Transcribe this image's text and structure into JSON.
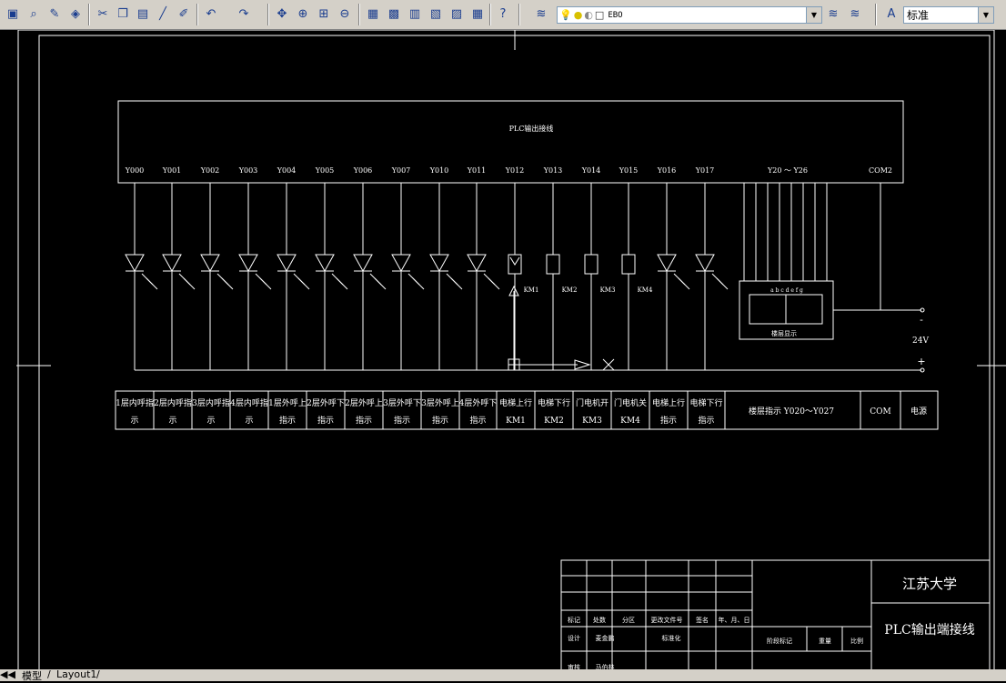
{
  "toolbar": {
    "layer_value": "EBO",
    "text_style_value": "标准",
    "icons": [
      "open-icon",
      "preview-icon",
      "publish-icon",
      "plot-icon",
      "cut-icon",
      "copy-icon",
      "paste-icon",
      "match-icon",
      "brush-icon",
      "undo-icon",
      "redo-icon",
      "pan-icon",
      "zoom-realtime-icon",
      "zoom-window-icon",
      "zoom-previous-icon",
      "properties-icon",
      "design-center-icon",
      "tool-palette-icon",
      "sheet-set-icon",
      "markup-icon",
      "quickcalc-icon",
      "help-icon"
    ]
  },
  "drawing": {
    "plc_title": "PLC输出接线",
    "output_labels": [
      "Y000",
      "Y001",
      "Y002",
      "Y003",
      "Y004",
      "Y005",
      "Y006",
      "Y007",
      "Y010",
      "Y011",
      "Y012",
      "Y013",
      "Y014",
      "Y015",
      "Y016",
      "Y017"
    ],
    "y20_label": "Y20 ～ Y26",
    "com2_label": "COM2",
    "relay_labels": [
      "KM1",
      "KM2",
      "KM3",
      "KM4"
    ],
    "display_segments": "a b c d e f g",
    "display_label": "楼层显示",
    "supply_voltage": "24V",
    "minus_sign": "-",
    "plus_sign": "+",
    "table_cells": [
      [
        "1层内呼指",
        "示"
      ],
      [
        "2层内呼指",
        "示"
      ],
      [
        "3层内呼指",
        "示"
      ],
      [
        "4层内呼指",
        "示"
      ],
      [
        "1层外呼上",
        "指示"
      ],
      [
        "2层外呼下",
        "指示"
      ],
      [
        "2层外呼上",
        "指示"
      ],
      [
        "3层外呼下",
        "指示"
      ],
      [
        "3层外呼上",
        "指示"
      ],
      [
        "4层外呼下",
        "指示"
      ],
      [
        "电梯上行",
        "KM1"
      ],
      [
        "电梯下行",
        "KM2"
      ],
      [
        "门电机开",
        "KM3"
      ],
      [
        "门电机关",
        "KM4"
      ],
      [
        "电梯上行",
        "指示"
      ],
      [
        "电梯下行",
        "指示"
      ]
    ],
    "floor_display_cell": "楼层指示 Y020～Y027",
    "com_cell": "COM",
    "power_cell": "电源"
  },
  "title_block": {
    "university": "江苏大学",
    "drawing_name": "PLC输出端接线",
    "row_labels": [
      "标记",
      "处数",
      "分区",
      "更改文件号",
      "签名",
      "年、月、日"
    ],
    "design_labels": [
      "设计",
      "麦金鹏",
      "标准化"
    ],
    "stage_labels": [
      "阶段标记",
      "重量",
      "比例"
    ],
    "review_labels": [
      "审核",
      "马伯林"
    ]
  },
  "tabs": {
    "model": "模型",
    "layout1": "Layout1"
  }
}
